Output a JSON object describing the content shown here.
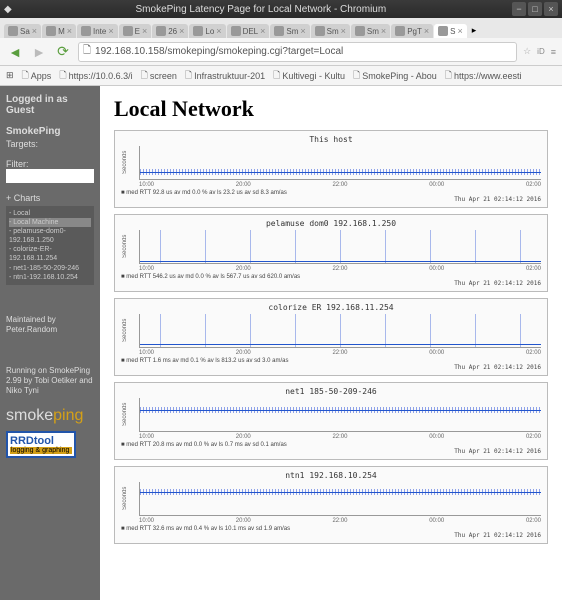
{
  "window": {
    "title": "SmokePing Latency Page for Local Network - Chromium"
  },
  "tabs": [
    {
      "label": "Sa"
    },
    {
      "label": "M"
    },
    {
      "label": "Inte"
    },
    {
      "label": "E"
    },
    {
      "label": "26"
    },
    {
      "label": "Lo"
    },
    {
      "label": "DEL"
    },
    {
      "label": "Sm"
    },
    {
      "label": "Sm"
    },
    {
      "label": "Sm"
    },
    {
      "label": "PgT"
    },
    {
      "label": "S",
      "active": true
    }
  ],
  "url": "192.168.10.158/smokeping/smokeping.cgi?target=Local",
  "bookmarks": [
    {
      "label": "Apps"
    },
    {
      "label": "https://10.0.6.3/i"
    },
    {
      "label": "screen"
    },
    {
      "label": "Infrastruktuur-201"
    },
    {
      "label": "Kultivegi - Kultu"
    },
    {
      "label": "SmokePing - Abou"
    },
    {
      "label": "https://www.eesti"
    }
  ],
  "sidebar": {
    "logged_in": "Logged in as Guest",
    "brand": "SmokePing",
    "targets_label": "Targets:",
    "filter_label": "Filter:",
    "charts_label": "+ Charts",
    "tree": [
      "Local",
      "Local Machine",
      "pelamuse-dom0-192.168.1.250",
      "colorize-ER-192.168.11.254",
      "net1-185-50-209-246",
      "ntn1-192.168.10.254"
    ],
    "maintained": "Maintained by Peter.Random",
    "running": "Running on SmokePing 2.99 by Tobi Oetiker and Niko Tyni",
    "logo1": "smoke",
    "logo1b": "ping",
    "rrd_t": "RRDtool",
    "rrd_s": "logging & graphing"
  },
  "page_title": "Local Network",
  "chart_data": [
    {
      "type": "line",
      "title": "This host",
      "ylabel": "Seconds",
      "ylim": [
        0,
        "200u"
      ],
      "xticks": [
        "10:00",
        "20:00",
        "22:00",
        "00:00",
        "02:00"
      ],
      "stats": "med RTT  92.8 us av md   0.0 % av ls  23.2 us av sd   8.3  am/as",
      "timestamp": "Thu Apr 21 02:14:12 2016",
      "line_y": 0.75,
      "noise": true
    },
    {
      "type": "line",
      "title": "pelamuse dom0 192.168.1.250",
      "ylabel": "Seconds",
      "ylim": [
        0,
        "6m"
      ],
      "xticks": [
        "10:00",
        "20:00",
        "22:00",
        "00:00",
        "02:00"
      ],
      "stats": "med RTT  546.2 us av md   0.0 % av ls  567.7 us av sd  620.0  am/as",
      "timestamp": "Thu Apr 21 02:14:12 2016",
      "line_y": 0.92,
      "noise": false,
      "spikes": true
    },
    {
      "type": "line",
      "title": "colorize ER 192.168.11.254",
      "ylabel": "Seconds",
      "ylim": [
        0,
        "8m"
      ],
      "xticks": [
        "10:00",
        "20:00",
        "22:00",
        "00:00",
        "02:00"
      ],
      "stats": "med RTT   1.6 ms av md   0.1 % av ls  813.2 us av sd   3.0  am/as",
      "timestamp": "Thu Apr 21 02:14:12 2016",
      "line_y": 0.88,
      "noise": false,
      "spikes": true
    },
    {
      "type": "line",
      "title": "net1 185-50-209-246",
      "ylabel": "Seconds",
      "ylim": [
        0,
        "30m"
      ],
      "xticks": [
        "10:00",
        "20:00",
        "22:00",
        "00:00",
        "02:00"
      ],
      "stats": "med RTT  20.8 ms av md   0.0 % av ls   0.7 ms av sd   0.1  am/as",
      "timestamp": "Thu Apr 21 02:14:12 2016",
      "line_y": 0.35,
      "noise": true
    },
    {
      "type": "line",
      "title": "ntn1 192.168.10.254",
      "ylabel": "Seconds",
      "ylim": [
        0,
        "40m"
      ],
      "xticks": [
        "10:00",
        "20:00",
        "22:00",
        "00:00",
        "02:00"
      ],
      "stats": "med RTT  32.6 ms av md   0.4 % av ls  10.1 ms av sd   1.9  am/as",
      "timestamp": "Thu Apr 21 02:14:12 2016",
      "line_y": 0.3,
      "noise": true
    }
  ]
}
